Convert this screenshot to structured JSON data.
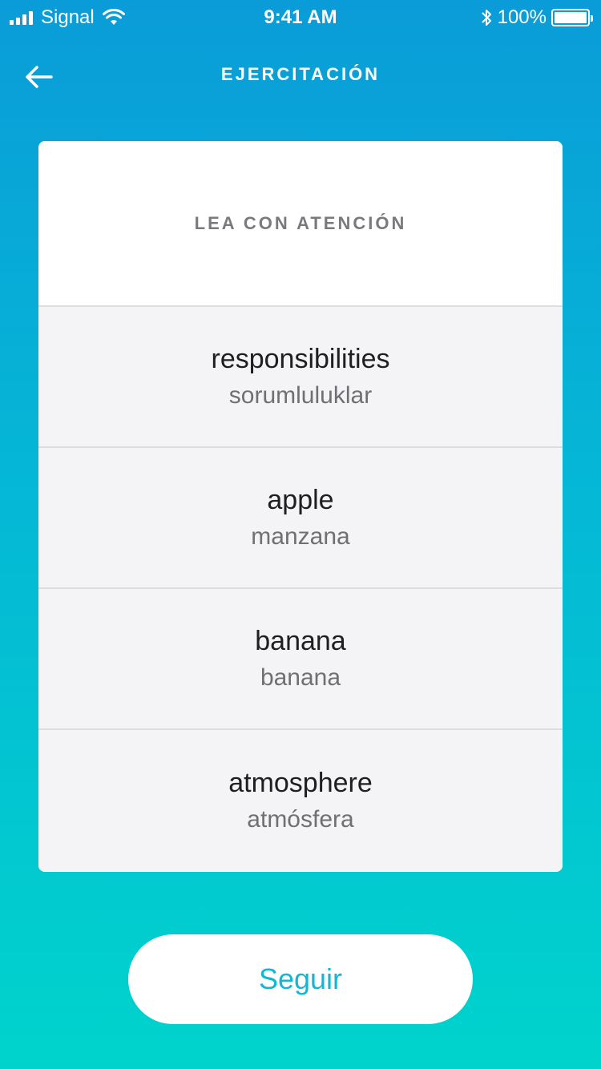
{
  "status_bar": {
    "carrier": "Signal",
    "time": "9:41 AM",
    "battery_percent": "100%",
    "icons": [
      "signal-bars-icon",
      "wifi-icon",
      "bluetooth-icon",
      "battery-icon"
    ]
  },
  "nav": {
    "title": "EJERCITACIÓN",
    "back_icon": "arrow-left-icon"
  },
  "card": {
    "title": "LEA CON ATENCIÓN",
    "words": [
      {
        "word": "responsibilities",
        "translation": "sorumluluklar"
      },
      {
        "word": "apple",
        "translation": "manzana"
      },
      {
        "word": "banana",
        "translation": "banana"
      },
      {
        "word": "atmosphere",
        "translation": "atmósfera"
      }
    ]
  },
  "actions": {
    "continue_label": "Seguir"
  },
  "colors": {
    "gradient_top": "#0a9cd8",
    "gradient_bottom": "#00d3cc",
    "accent": "#13b7d6"
  }
}
